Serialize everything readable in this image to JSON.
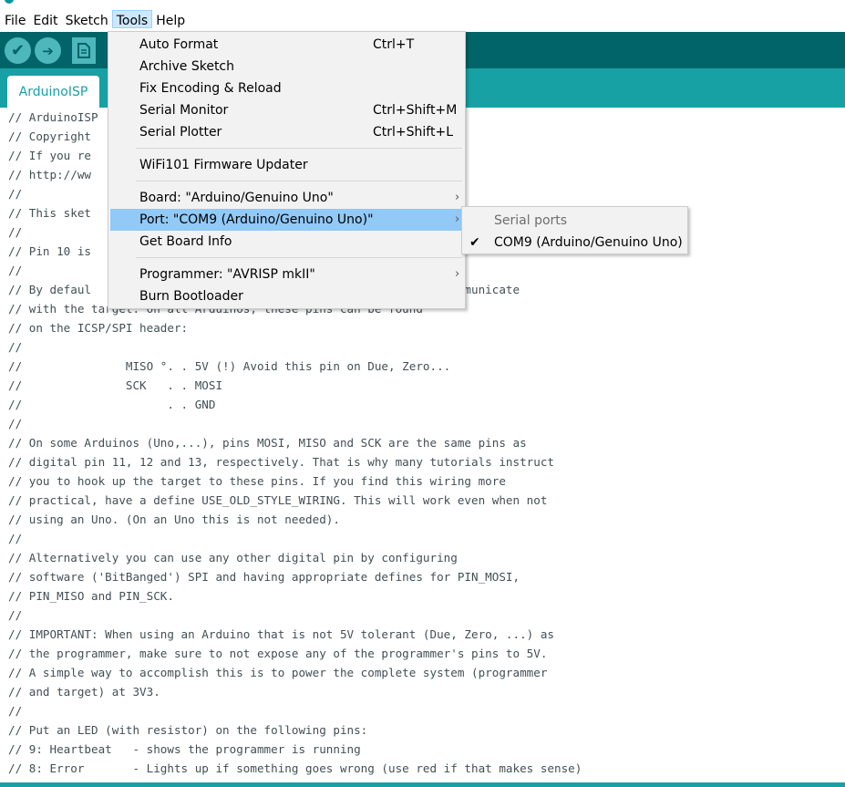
{
  "menubar": [
    {
      "label": "File"
    },
    {
      "label": "Edit"
    },
    {
      "label": "Sketch"
    },
    {
      "label": "Tools",
      "active": true
    },
    {
      "label": "Help"
    }
  ],
  "toolbar": {
    "buttons": [
      {
        "name": "verify-button",
        "icon": "check-icon",
        "glyph": "✔"
      },
      {
        "name": "upload-button",
        "icon": "arrow-right-icon",
        "glyph": "➔"
      },
      {
        "name": "new-button",
        "icon": "document-icon"
      }
    ]
  },
  "tab": {
    "label": "ArduinoISP"
  },
  "tools_menu": {
    "items": [
      {
        "label": "Auto Format",
        "shortcut": "Ctrl+T"
      },
      {
        "label": "Archive Sketch",
        "shortcut": ""
      },
      {
        "label": "Fix Encoding & Reload",
        "shortcut": ""
      },
      {
        "label": "Serial Monitor",
        "shortcut": "Ctrl+Shift+M"
      },
      {
        "label": "Serial Plotter",
        "shortcut": "Ctrl+Shift+L"
      },
      {
        "separator": true
      },
      {
        "label": "WiFi101 Firmware Updater",
        "shortcut": ""
      },
      {
        "separator": true
      },
      {
        "label": "Board: \"Arduino/Genuino Uno\"",
        "submenu": true
      },
      {
        "label": "Port: \"COM9 (Arduino/Genuino Uno)\"",
        "submenu": true,
        "highlighted": true
      },
      {
        "label": "Get Board Info",
        "shortcut": ""
      },
      {
        "separator": true
      },
      {
        "label": "Programmer: \"AVRISP mkII\"",
        "submenu": true
      },
      {
        "label": "Burn Bootloader",
        "shortcut": ""
      }
    ]
  },
  "port_submenu": {
    "header": "Serial ports",
    "items": [
      {
        "label": "COM9 (Arduino/Genuino Uno)",
        "checked": true
      }
    ]
  },
  "code_lines": [
    "// ArduinoISP",
    "// Copyright",
    "// If you re",
    "// http://ww",
    "//",
    "// This sket",
    "//",
    "// Pin 10 is",
    "//",
    "// By defaul                                       are used to communicate",
    "// with the target. On all Arduinos, these pins can be found",
    "// on the ICSP/SPI header:",
    "//",
    "//               MISO °. . 5V (!) Avoid this pin on Due, Zero...",
    "//               SCK   . . MOSI",
    "//                     . . GND",
    "//",
    "// On some Arduinos (Uno,...), pins MOSI, MISO and SCK are the same pins as",
    "// digital pin 11, 12 and 13, respectively. That is why many tutorials instruct",
    "// you to hook up the target to these pins. If you find this wiring more",
    "// practical, have a define USE_OLD_STYLE_WIRING. This will work even when not",
    "// using an Uno. (On an Uno this is not needed).",
    "//",
    "// Alternatively you can use any other digital pin by configuring",
    "// software ('BitBanged') SPI and having appropriate defines for PIN_MOSI,",
    "// PIN_MISO and PIN_SCK.",
    "//",
    "// IMPORTANT: When using an Arduino that is not 5V tolerant (Due, Zero, ...) as",
    "// the programmer, make sure to not expose any of the programmer's pins to 5V.",
    "// A simple way to accomplish this is to power the complete system (programmer",
    "// and target) at 3V3.",
    "//",
    "// Put an LED (with resistor) on the following pins:",
    "// 9: Heartbeat   - shows the programmer is running",
    "// 8: Error       - Lights up if something goes wrong (use red if that makes sense)"
  ],
  "colors": {
    "toolbar": "#006468",
    "tabbar": "#17a1a5",
    "highlight": "#91c9f7",
    "code_text": "#434f54"
  }
}
